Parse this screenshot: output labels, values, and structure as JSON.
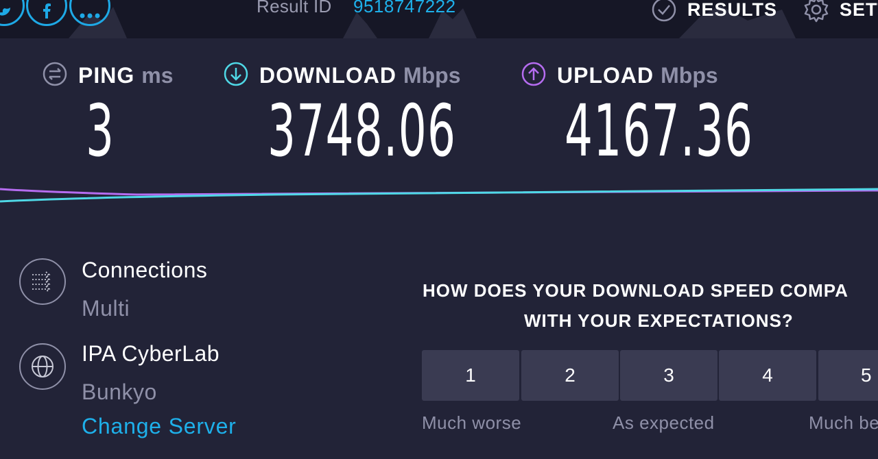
{
  "header": {
    "share_icons": [
      "twitter-icon",
      "facebook-icon",
      "more-icon"
    ],
    "result_label": "Result ID",
    "result_id": "9518747222",
    "results_label": "RESULTS",
    "settings_label": "SETT"
  },
  "metrics": {
    "ping": {
      "title": "PING",
      "unit": "ms",
      "value": "3",
      "icon": "ping-icon"
    },
    "download": {
      "title": "DOWNLOAD",
      "unit": "Mbps",
      "value": "3748.06",
      "icon": "download-arrow-icon"
    },
    "upload": {
      "title": "UPLOAD",
      "unit": "Mbps",
      "value": "4167.36",
      "icon": "upload-arrow-icon"
    }
  },
  "server": {
    "connections_title": "Connections",
    "connections_value": "Multi",
    "host": "IPA CyberLab",
    "location": "Bunkyo",
    "change_server": "Change Server"
  },
  "survey": {
    "question_line1": "HOW DOES YOUR DOWNLOAD SPEED COMPA",
    "question_line2": "WITH YOUR EXPECTATIONS?",
    "ratings": [
      "1",
      "2",
      "3",
      "4",
      "5"
    ],
    "label_low": "Much worse",
    "label_mid": "As expected",
    "label_high": "Much be"
  },
  "colors": {
    "background": "#222337",
    "accent_blue": "#1eb0ea",
    "download_cyan": "#4fd8e6",
    "upload_purple": "#b56cf0",
    "muted": "#8f90a8"
  }
}
